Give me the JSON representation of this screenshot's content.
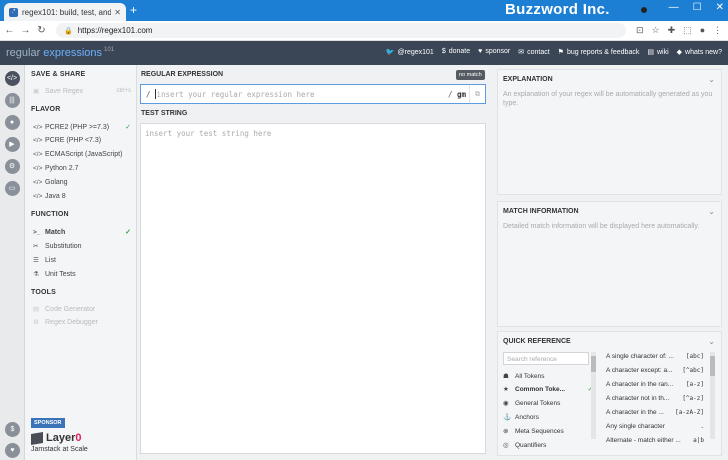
{
  "browser": {
    "tab_title": "regex101: build, test, and debug",
    "tab_close": "✕",
    "new_tab": "+",
    "banner": "Buzzword Inc.",
    "url": "https://regex101.com",
    "window_controls": [
      "—",
      "☐",
      "✕"
    ]
  },
  "site": {
    "logo_a": "regular",
    "logo_b": " expressions",
    "logo_c": "101",
    "links": [
      {
        "icon": "twitter-icon",
        "label": "@regex101"
      },
      {
        "icon": "donate-icon",
        "label": "donate"
      },
      {
        "icon": "heart-icon",
        "label": "sponsor"
      },
      {
        "icon": "mail-icon",
        "label": "contact"
      },
      {
        "icon": "bug-icon",
        "label": "bug reports & feedback"
      },
      {
        "icon": "book-icon",
        "label": "wiki"
      },
      {
        "icon": "megaphone-icon",
        "label": "whats new?"
      }
    ]
  },
  "sidebar": {
    "save_share": "SAVE & SHARE",
    "save_regex": "Save Regex",
    "save_shortcut": "ctrl+s",
    "flavor": "FLAVOR",
    "flavors": [
      {
        "label": "PCRE2 (PHP >=7.3)",
        "selected": true
      },
      {
        "label": "PCRE (PHP <7.3)"
      },
      {
        "label": "ECMAScript (JavaScript)"
      },
      {
        "label": "Python 2.7"
      },
      {
        "label": "Golang"
      },
      {
        "label": "Java 8"
      }
    ],
    "function": "FUNCTION",
    "functions": [
      {
        "label": "Match",
        "selected": true
      },
      {
        "label": "Substitution"
      },
      {
        "label": "List"
      },
      {
        "label": "Unit Tests"
      }
    ],
    "tools": "TOOLS",
    "tool_items": [
      "Code Generator",
      "Regex Debugger"
    ],
    "sponsor": "SPONSOR",
    "sponsor_name_a": "Layer",
    "sponsor_name_b": "0",
    "sponsor_tag": "Jamstack at Scale"
  },
  "editor": {
    "regex_label": "REGULAR EXPRESSION",
    "no_match": "no match",
    "delim_open": "/",
    "regex_placeholder": "insert your regular expression here",
    "delim_close": "/",
    "flags": "gm",
    "test_label": "TEST STRING",
    "test_placeholder": "insert your test string here"
  },
  "panels": {
    "explanation_title": "EXPLANATION",
    "explanation_text": "An explanation of your regex will be automatically generated as you type.",
    "match_title": "MATCH INFORMATION",
    "match_text": "Detailed match information will be displayed here automatically.",
    "quickref_title": "QUICK REFERENCE",
    "search_placeholder": "Search reference",
    "categories": [
      {
        "label": "All Tokens"
      },
      {
        "label": "Common Toke...",
        "selected": true
      },
      {
        "label": "General Tokens"
      },
      {
        "label": "Anchors"
      },
      {
        "label": "Meta Sequences"
      },
      {
        "label": "Quantifiers"
      }
    ],
    "tokens": [
      {
        "desc": "A single character of: ...",
        "tok": "[abc]"
      },
      {
        "desc": "A character except: a...",
        "tok": "[^abc]"
      },
      {
        "desc": "A character in the ran...",
        "tok": "[a-z]"
      },
      {
        "desc": "A character not in th...",
        "tok": "[^a-z]"
      },
      {
        "desc": "A character in the ...",
        "tok": "[a-zA-Z]"
      },
      {
        "desc": "Any single character",
        "tok": "."
      },
      {
        "desc": "Alternate - match either ...",
        "tok": "a|b"
      }
    ]
  }
}
